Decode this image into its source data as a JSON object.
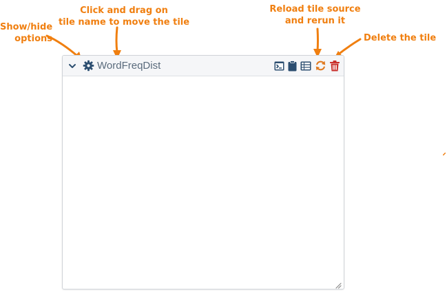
{
  "annotations": {
    "show_hide": "Show/hide\noptions",
    "drag": "Click and drag on\ntile name to move the tile",
    "reload": "Reload tile source\nand rerun it",
    "delete": "Delete the tile"
  },
  "tile": {
    "name": "WordFreqDist",
    "icons": {
      "collapse": "chevron-down-icon",
      "options": "gear-icon",
      "console": "terminal-icon",
      "clipboard": "clipboard-icon",
      "table": "table-icon",
      "reload": "reload-icon",
      "delete": "trash-icon"
    }
  },
  "colors": {
    "annotation": "#f07f10",
    "icon_primary": "#2c4e70",
    "tile_name": "#5a6b7c",
    "reload": "#e07a20",
    "delete": "#c9302c"
  }
}
